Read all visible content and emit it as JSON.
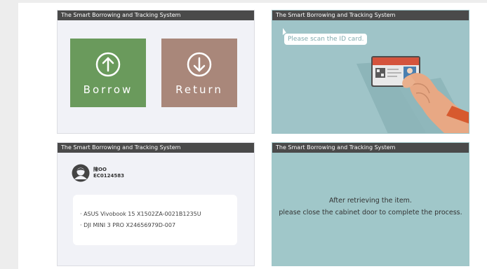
{
  "system_title": "The Smart Borrowing and Tracking System",
  "panels": {
    "home": {
      "borrow_label": "Borrow",
      "return_label": "Return",
      "borrow_icon": "arrow-up-circle-icon",
      "return_icon": "arrow-down-circle-icon"
    },
    "scan": {
      "prompt": "Please scan the ID card."
    },
    "user": {
      "name": "陳OO",
      "employee_id": "EC0124583",
      "items": [
        "· ASUS Vivobook 15 X1502ZA-0021B1235U",
        "· DJI MINI 3 PRO X24656979D-007"
      ]
    },
    "done": {
      "line1": "After retrieving the item.",
      "line2": "please close the cabinet door to complete the process."
    }
  },
  "colors": {
    "borrow": "#6a9a5c",
    "return": "#a9877a",
    "titlebar": "#4a4a4a",
    "teal": "#9fc4c8"
  }
}
